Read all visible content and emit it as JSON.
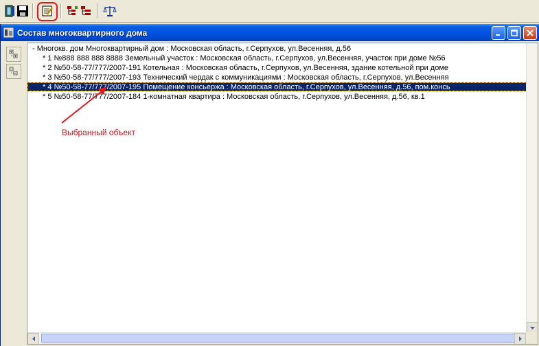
{
  "toolbar": {
    "buttons": [
      {
        "icon": "exit-door-icon"
      },
      {
        "icon": "save-floppy-icon"
      },
      {
        "icon": "edit-document-icon",
        "highlighted": true
      },
      {
        "icon": "tree-expand-icon"
      },
      {
        "icon": "tree-collapse-icon"
      },
      {
        "icon": "scales-icon"
      }
    ],
    "highlight_color": "#e2161b"
  },
  "window": {
    "title": "Состав многоквартирного дома",
    "title_bar_color": "#0054e3"
  },
  "side_buttons": [
    {
      "icon": "expand-all-icon"
    },
    {
      "icon": "collapse-all-icon"
    }
  ],
  "tree": {
    "root": "- Многокв. дом Многоквартирный дом : Московская область, г.Серпухов, ул.Весенняя, д.56",
    "children": [
      {
        "label": "* 1 №888 888 888 8888 Земельный участок : Московская область, г.Серпухов, ул.Весенняя, участок при доме №56",
        "selected": false
      },
      {
        "label": "* 2 №50-58-77/777/2007-191 Котельная : Московская область, г.Серпухов, ул.Весенняя, здание котельной при доме",
        "selected": false
      },
      {
        "label": "* 3 №50-58-77/777/2007-193 Технический чердак с коммуникациями : Московская область, г.Серпухов, ул.Весенняя",
        "selected": false
      },
      {
        "label": "* 4 №50-58-77/777/2007-195 Помещение консьержа : Московская область, г.Серпухов, ул.Весенняя, д.56, пом.консь",
        "selected": true
      },
      {
        "label": "* 5 №50-58-77/777/2007-184 1-комнатная квартира : Московская область, г.Серпухов, ул.Весенняя, д.56, кв.1",
        "selected": false
      }
    ],
    "selection_color": "#0a246a"
  },
  "annotation": {
    "text": "Выбранный объект",
    "color": "#c8171b"
  }
}
